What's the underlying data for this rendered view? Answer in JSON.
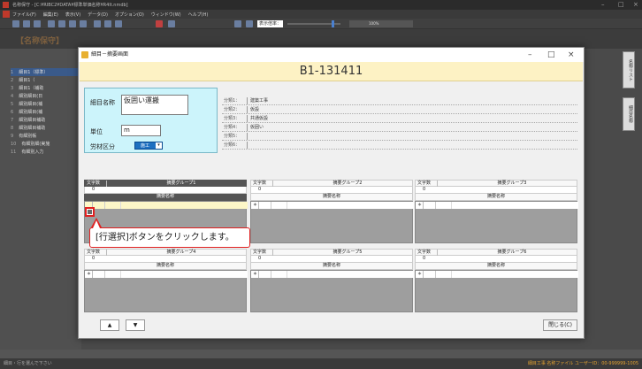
{
  "app": {
    "title": "名称保守 - [C:¥RIBC2¥DATA¥標準単価名称¥R4lt.nmdb]",
    "menu": [
      "ファイル(F)",
      "編集(E)",
      "表示(V)",
      "データ(D)",
      "オプション(O)",
      "ウィンドウ(W)",
      "ヘルプ(H)"
    ],
    "zoom_label": "表示倍率：",
    "zoom_value": "100%",
    "bg_title": "【名称保守】",
    "status_left": "細目・行を選んで下さい",
    "status_right": "細目工事 名称ファイル ユーザーID：00-999999-1005"
  },
  "left_list": [
    {
      "num": "1",
      "label": "細目1（標準）"
    },
    {
      "num": "2",
      "label": "細目1（"
    },
    {
      "num": "3",
      "label": "細目1（補助"
    },
    {
      "num": "4",
      "label": "細別細目(日"
    },
    {
      "num": "5",
      "label": "細別細目(補"
    },
    {
      "num": "6",
      "label": "細別細目(補"
    },
    {
      "num": "7",
      "label": "細別細目補助"
    },
    {
      "num": "8",
      "label": "細別細目補助"
    },
    {
      "num": "9",
      "label": "有細別帳"
    },
    {
      "num": "10",
      "label": "有細別細(実施"
    },
    {
      "num": "11",
      "label": "有細別入力"
    }
  ],
  "right_tabs": [
    "名称リスト",
    "細目名称"
  ],
  "dialog": {
    "title": "細目－摘要画面",
    "header_code": "B1-131411",
    "fields": {
      "name_label": "細目名称",
      "name_value": "仮囲い運搬",
      "unit_label": "単位",
      "unit_value": "m",
      "labor_label": "労材区分",
      "labor_value": "施工"
    },
    "classifications": [
      {
        "label": "分類1：",
        "value": "建築工事"
      },
      {
        "label": "分類2：",
        "value": "仮設"
      },
      {
        "label": "分類3：",
        "value": "共通仮設"
      },
      {
        "label": "分類4：",
        "value": "仮囲い"
      },
      {
        "label": "分類5：",
        "value": ""
      },
      {
        "label": "分類6：",
        "value": ""
      }
    ],
    "groups": [
      {
        "mojisu": "文字数",
        "title": "摘要グループ1",
        "count": "0",
        "name_hdr": "摘要名称",
        "active": true
      },
      {
        "mojisu": "文字数",
        "title": "摘要グループ2",
        "count": "0",
        "name_hdr": "摘要名称",
        "active": false
      },
      {
        "mojisu": "文字数",
        "title": "摘要グループ3",
        "count": "0",
        "name_hdr": "摘要名称",
        "active": false
      },
      {
        "mojisu": "文字数",
        "title": "摘要グループ4",
        "count": "0",
        "name_hdr": "摘要名称",
        "active": false
      },
      {
        "mojisu": "文字数",
        "title": "摘要グループ5",
        "count": "0",
        "name_hdr": "摘要名称",
        "active": false
      },
      {
        "mojisu": "文字数",
        "title": "摘要グループ6",
        "count": "0",
        "name_hdr": "摘要名称",
        "active": false
      }
    ],
    "star": "＊",
    "callout": "[行選択]ボタンをクリックします。",
    "up_label": "▲",
    "down_label": "▼",
    "close_label": "閉じる(C)"
  }
}
